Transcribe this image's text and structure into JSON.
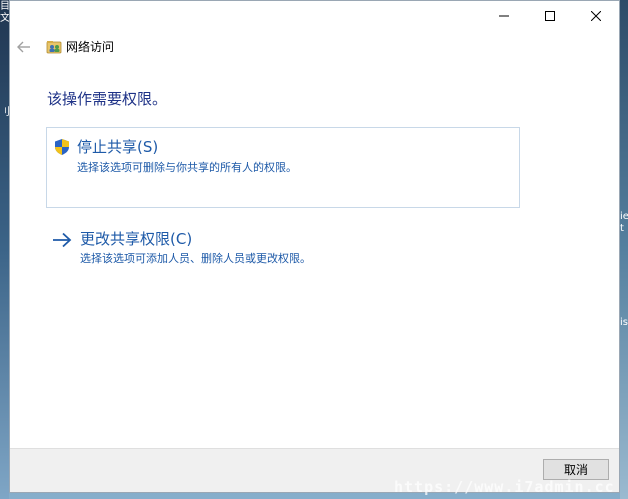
{
  "window": {
    "app_title": "网络访问",
    "heading": "该操作需要权限。"
  },
  "options": [
    {
      "title": "停止共享(S)",
      "description": "选择该选项可删除与你共享的所有人的权限。",
      "icon": "uac-shield-icon"
    },
    {
      "title": "更改共享权限(C)",
      "description": "选择该选项可添加人员、删除人员或更改权限。",
      "icon": "arrow-right-icon"
    }
  ],
  "footer": {
    "cancel_label": "取消"
  },
  "watermark": "https://www.i7admin.cc",
  "desktop": {
    "left_glyphs": [
      "目",
      "文",
      "刂"
    ],
    "right_glyphs": [
      "ie",
      "t",
      "is"
    ]
  },
  "colors": {
    "heading": "#1e3287",
    "link": "#1e5aa8",
    "option_border": "#c8d8e8",
    "footer_bg": "#f0f0f0"
  }
}
